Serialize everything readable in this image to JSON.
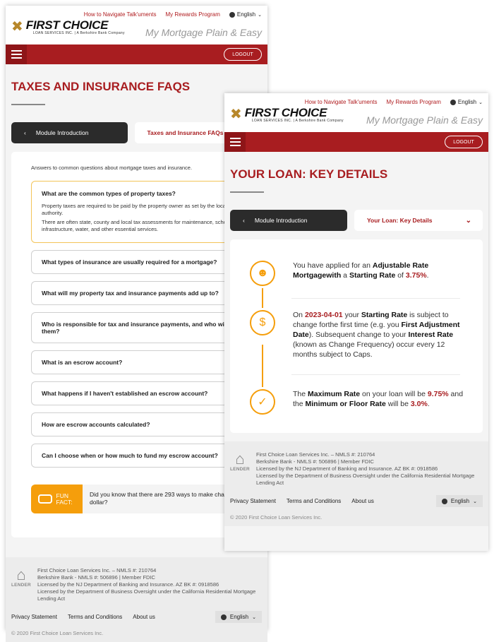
{
  "header": {
    "links": [
      "How to Navigate Talk'uments",
      "My Rewards Program"
    ],
    "language": "English",
    "logo_main": "FIRST CHOICE",
    "logo_sub": "LOAN SERVICES INC. | A Berkshire Bank Company",
    "tagline": "My Mortgage Plain & Easy",
    "logout": "LOGOUT"
  },
  "screen1": {
    "title": "TAXES AND INSURANCE FAQS",
    "tab_back": "Module Introduction",
    "tab_current": "Taxes and Insurance FAQs",
    "intro": "Answers to common questions about mortgage taxes and insurance.",
    "faqs": [
      {
        "q": "What are the common types of property taxes?",
        "a": [
          "Property taxes are required to be paid by the property owner as set by the local tax authority.",
          "There are often state, county and local tax assessments for maintenance, schools, infrastructure, water, and other essential services."
        ]
      },
      {
        "q": "What types of insurance are usually required for a mortgage?"
      },
      {
        "q": "What will my property tax and insurance payments add up to?"
      },
      {
        "q": "Who is responsible for tax and insurance payments, and who will make them?"
      },
      {
        "q": "What is an escrow account?"
      },
      {
        "q": "What happens if I haven't established an escrow account?"
      },
      {
        "q": "How are escrow accounts calculated?"
      },
      {
        "q": "Can I choose when or how much to fund my escrow account?"
      }
    ],
    "fun_fact_label": "FUN FACT:",
    "fun_fact": "Did you know that there are 293 ways to make change for a dollar?"
  },
  "screen2": {
    "title": "YOUR LOAN: KEY DETAILS",
    "tab_back": "Module Introduction",
    "tab_current": "Your Loan: Key Details",
    "details": {
      "starting_rate": "3.75%",
      "first_adjustment_date": "2023-04-01",
      "change_frequency_months": "12",
      "maximum_rate": "9.75%",
      "floor_rate": "3.0%"
    }
  },
  "footer": {
    "eho": "LENDER",
    "license_lines": [
      "First Choice Loan Services Inc. – NMLS #: 210764",
      "Berkshire Bank - NMLS #: 506896 | Member FDIC",
      "Licensed by the NJ Department of Banking and Insurance. AZ BK #: 0918586",
      "Licensed by the Department of Business Oversight under the California Residential Mortgage Lending Act"
    ],
    "links": [
      "Privacy Statement",
      "Terms and Conditions",
      "About us"
    ],
    "language": "English",
    "copyright": "© 2020 First Choice Loan Services Inc."
  },
  "colors": {
    "brand_red": "#a81d20",
    "accent_orange": "#f59e0b",
    "logo_gold": "#b7872a"
  }
}
